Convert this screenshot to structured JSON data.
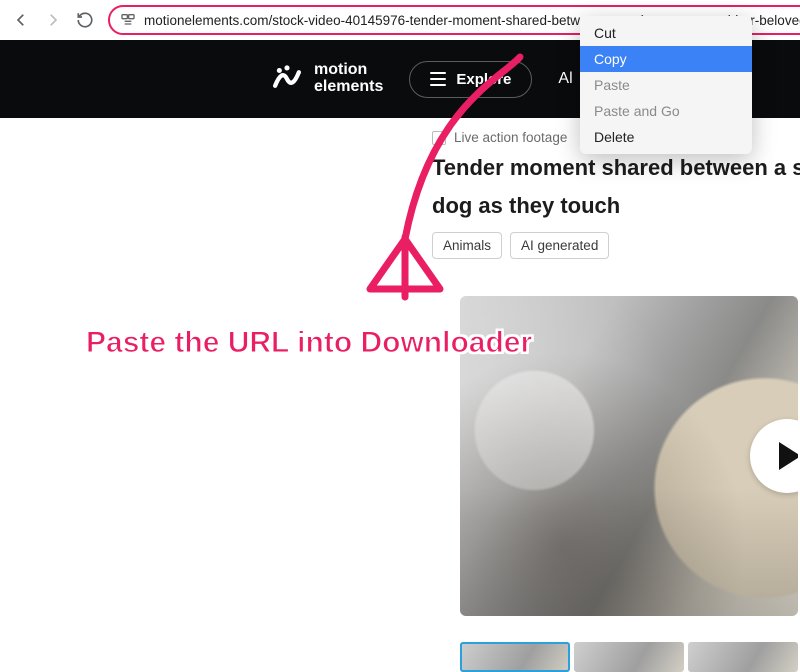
{
  "browser": {
    "url": "motionelements.com/stock-video-40145976-tender-moment-shared-between-a-senior-woman-and-her-beloved"
  },
  "context_menu": {
    "items": [
      {
        "label": "Cut",
        "state": "normal"
      },
      {
        "label": "Copy",
        "state": "highlight"
      },
      {
        "label": "Paste",
        "state": "disabled"
      },
      {
        "label": "Paste and Go",
        "state": "disabled"
      },
      {
        "label": "Delete",
        "state": "normal"
      }
    ]
  },
  "site": {
    "logo_line1": "motion",
    "logo_line2": "elements",
    "explore_label": "Explore",
    "nav_partial": "Al"
  },
  "page": {
    "footage_type": "Live action footage",
    "title_line1": "Tender moment shared between a se",
    "title_line2": "dog as they touch",
    "tags": [
      "Animals",
      "AI generated"
    ]
  },
  "annotation": {
    "text": "Paste the URL into Downloader"
  },
  "colors": {
    "highlight_pink": "#e91e63",
    "menu_highlight": "#3b82f6",
    "header_bg": "#0a0b0d"
  }
}
